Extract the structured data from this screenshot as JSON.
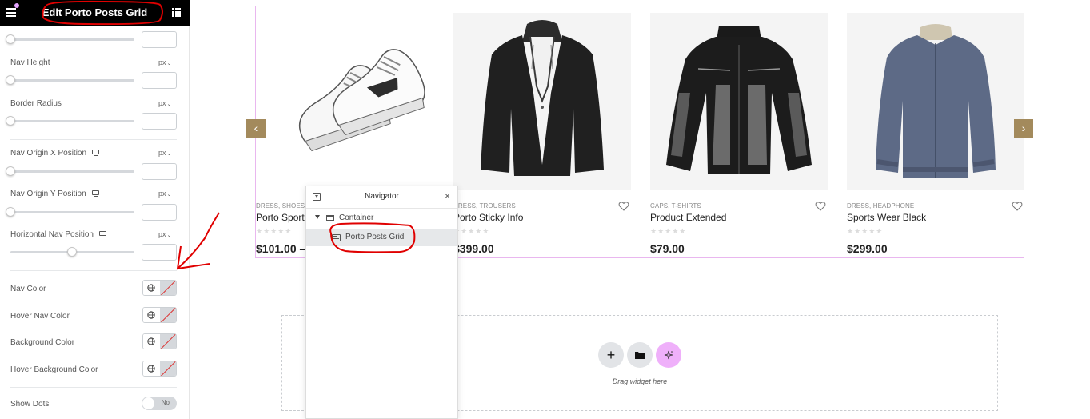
{
  "panel": {
    "title": "Edit Porto Posts Grid",
    "controls": [
      {
        "label": "",
        "unit": ""
      },
      {
        "label": "Nav Height",
        "unit": "px"
      },
      {
        "label": "Border Radius",
        "unit": "px"
      },
      {
        "label": "Nav Origin X Position",
        "unit": "px"
      },
      {
        "label": "Nav Origin Y Position",
        "unit": "px"
      },
      {
        "label": "Horizontal Nav Position",
        "unit": "px"
      }
    ],
    "colors": [
      {
        "label": "Nav Color"
      },
      {
        "label": "Hover Nav Color"
      },
      {
        "label": "Background Color"
      },
      {
        "label": "Hover Background Color"
      }
    ],
    "show_dots": {
      "label": "Show Dots",
      "value": "No"
    }
  },
  "carousel": {
    "prev": "‹",
    "next": "›",
    "products": [
      {
        "categories": "DRESS, SHOES",
        "name": "Porto Sports",
        "price": "$101.00 –",
        "rating": "★★★★★",
        "image": "white-sneakers"
      },
      {
        "categories": "DRESS, TROUSERS",
        "name": "Porto Sticky Info",
        "price": "$399.00",
        "rating": "★★★★★",
        "image": "black-blazer"
      },
      {
        "categories": "CAPS, T-SHIRTS",
        "name": "Product Extended",
        "price": "$79.00",
        "rating": "★★★★★",
        "image": "black-work-jacket"
      },
      {
        "categories": "DRESS, HEADPHONE",
        "name": "Sports Wear Black",
        "price": "$299.00",
        "rating": "★★★★★",
        "image": "grey-zip-cardigan"
      }
    ]
  },
  "navigator": {
    "title": "Navigator",
    "close": "×",
    "tree": {
      "container": "Container",
      "widget": "Porto Posts Grid"
    }
  },
  "dropzone": {
    "add": "+",
    "text": "Drag widget here"
  },
  "colors": {
    "accent_arrow": "#a38a5c",
    "selection_border": "#e9b7ef",
    "annotation_red": "#e00000",
    "ai_button": "#efb0fa"
  }
}
